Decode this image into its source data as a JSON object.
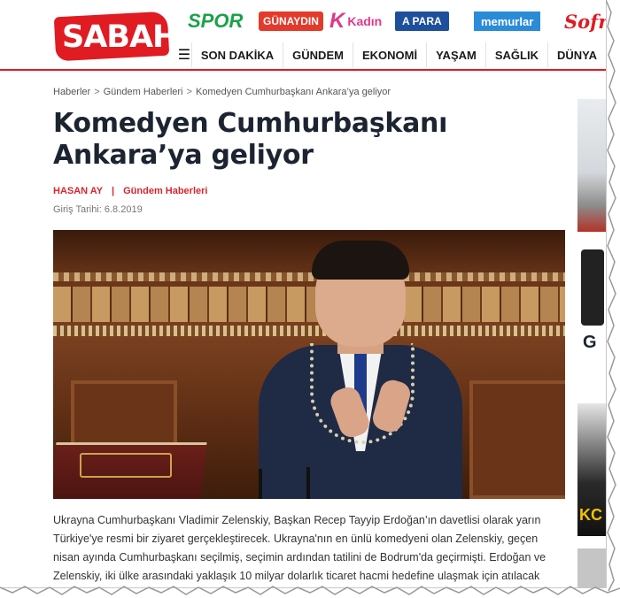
{
  "header": {
    "logo_text": "SABAH",
    "brands": {
      "spor": "SPOR",
      "gunaydin": "GÜNAYDIN",
      "kadin_initial": "K",
      "kadin": "Kadın",
      "apara": "A PARA",
      "memurlar": "memurlar",
      "sofra": "Sofra"
    },
    "menu_icon": "menu-icon",
    "nav": [
      "SON DAKİKA",
      "GÜNDEM",
      "EKONOMİ",
      "YAŞAM",
      "SAĞLIK",
      "DÜNYA"
    ]
  },
  "breadcrumb": {
    "items": [
      "Haberler",
      "Gündem Haberleri",
      "Komedyen Cumhurbaşkanı Ankara’ya geliyor"
    ],
    "separator": ">"
  },
  "article": {
    "title": "Komedyen Cumhurbaşkanı Ankara’ya geliyor",
    "author": "HASAN AY",
    "divider": "|",
    "category": "Gündem Haberleri",
    "date": "Giriş Tarihi: 6.8.2019",
    "body": "Ukrayna Cumhurbaşkanı Vladimir Zelenskiy, Başkan Recep Tayyip Erdoğan’ın davetlisi olarak yarın Türkiye'ye resmi bir ziyaret gerçekleştirecek. Ukrayna'nın en ünlü komedyeni olan Zelenskiy, geçen nisan ayında Cumhurbaşkanı seçilmiş, seçimin ardından tatilini de Bodrum'da geçirmişti. Erdoğan ve Zelenskiy, iki ülke arasındaki yaklaşık 10 milyar dolarlık ticaret hacmi hedefine ulaşmak için atılacak"
  },
  "rail": {
    "item2_text": "G",
    "item3_text": "KC"
  },
  "colors": {
    "brand_red": "#e01b22",
    "title": "#1c2431",
    "meta_red": "#d6262d"
  }
}
